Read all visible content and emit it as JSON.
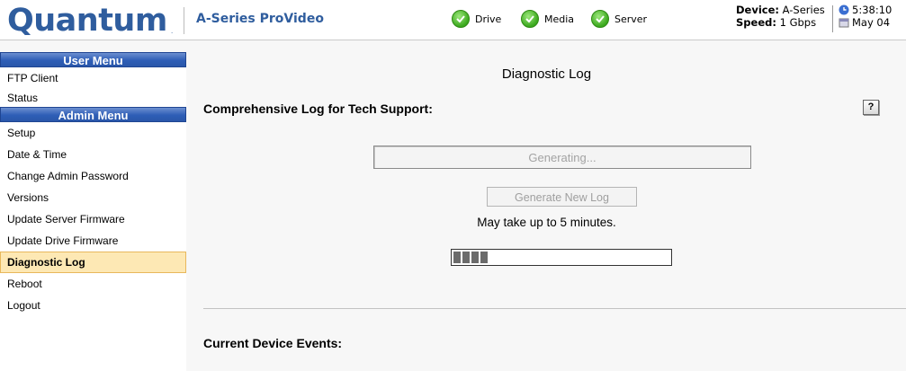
{
  "header": {
    "logo": "Quantum",
    "logo_mark": ".",
    "product": "A-Series ProVideo",
    "statuses": [
      {
        "label": "Drive",
        "icon": "check-circle-icon"
      },
      {
        "label": "Media",
        "icon": "check-circle-icon"
      },
      {
        "label": "Server",
        "icon": "check-circle-icon"
      }
    ],
    "device_label": "Device:",
    "device_value": "A-Series",
    "speed_label": "Speed:",
    "speed_value": "1 Gbps",
    "time": "5:38:10",
    "date": "May 04"
  },
  "sidebar": {
    "user_menu_title": "User Menu",
    "user_items": [
      "FTP Client",
      "Status"
    ],
    "admin_menu_title": "Admin Menu",
    "admin_items": [
      "Setup",
      "Date & Time",
      "Change Admin Password",
      "Versions",
      "Update Server Firmware",
      "Update Drive Firmware",
      "Diagnostic Log",
      "Reboot",
      "Logout"
    ],
    "active_item": "Diagnostic Log"
  },
  "main": {
    "title": "Diagnostic Log",
    "section_title": "Comprehensive Log for Tech Support:",
    "help_label": "?",
    "generating_text": "Generating...",
    "generate_button": "Generate New Log",
    "note": "May take up to 5 minutes.",
    "progress_fraction": 0.16,
    "events_title": "Current Device Events:"
  },
  "colors": {
    "brand": "#2f5d9e",
    "menu_header": "#2e5eb6",
    "active_item_bg": "#fde8b4",
    "status_ok": "#3aa81d"
  }
}
